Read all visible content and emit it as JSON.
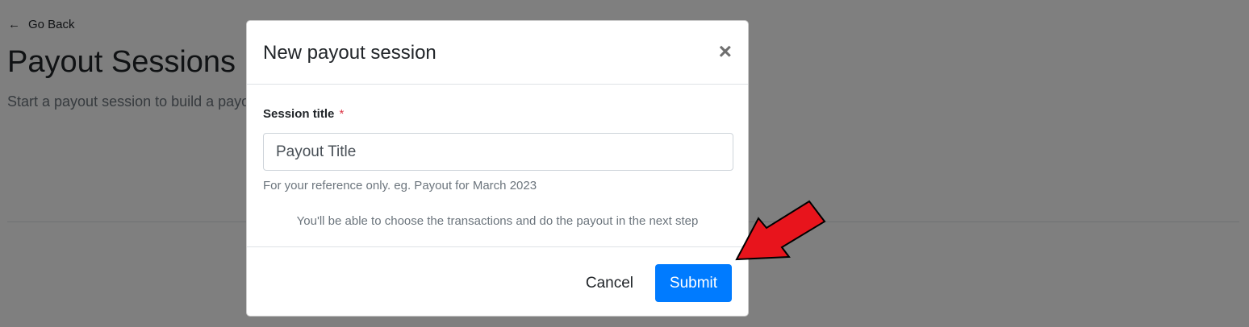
{
  "page": {
    "back_label": "Go Back",
    "title": "Payout Sessions",
    "subtitle": "Start a payout session to build a payout"
  },
  "modal": {
    "title": "New payout session",
    "close_symbol": "×",
    "field_label": "Session title",
    "required_marker": "*",
    "input_value": "Payout Title",
    "help_text": "For your reference only. eg. Payout for March 2023",
    "info_text": "You'll be able to choose the transactions and do the payout in the next step",
    "cancel_label": "Cancel",
    "submit_label": "Submit"
  },
  "icons": {
    "back": "arrow-left-icon",
    "close": "close-icon",
    "annotation": "red-arrow-icon"
  },
  "colors": {
    "primary": "#007bff",
    "required": "#dc3545",
    "annotation": "#e8141c",
    "backdrop": "rgba(0,0,0,0.5)"
  }
}
